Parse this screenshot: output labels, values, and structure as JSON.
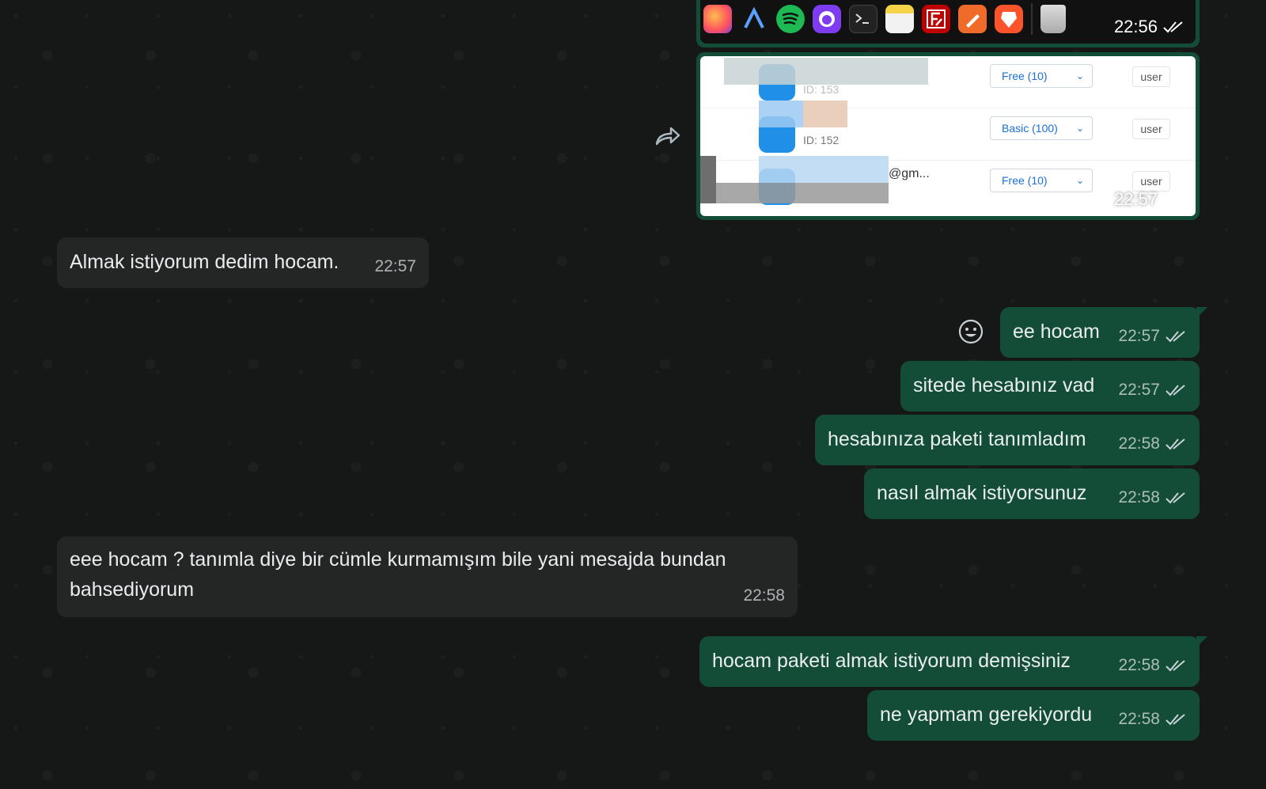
{
  "colors": {
    "background": "#161717",
    "incoming_bubble": "#242626",
    "outgoing_bubble": "#144d37",
    "text": "#e9edef",
    "meta_text": "#a9b0b3"
  },
  "dock": {
    "apps": [
      "firefox-icon",
      "arc-icon",
      "spotify-icon",
      "github-icon",
      "terminal-icon",
      "notes-icon",
      "filezilla-icon",
      "pencil-icon",
      "brave-icon",
      "trash-icon"
    ],
    "time": "22:56"
  },
  "screenshot": {
    "rows": [
      {
        "id": "ID: 153",
        "plan": "Free (10)",
        "role": "user"
      },
      {
        "id": "ID: 152",
        "plan": "Basic (100)",
        "role": "user"
      },
      {
        "email": "@gm...",
        "plan": "Free (10)",
        "role": "user"
      }
    ],
    "time": "22:57"
  },
  "messages": [
    {
      "text": "Almak istiyorum dedim hocam.",
      "time": "22:57"
    },
    {
      "text": "ee hocam",
      "time": "22:57"
    },
    {
      "text": "sitede hesabınız vad",
      "time": "22:57"
    },
    {
      "text": "hesabınıza paketi tanımladım",
      "time": "22:58"
    },
    {
      "text": "nasıl almak istiyorsunuz",
      "time": "22:58"
    },
    {
      "text": "eee hocam ? tanımla diye bir cümle kurmamışım bile yani mesajda bundan bahsediyorum",
      "time": "22:58"
    },
    {
      "text": "hocam paketi almak istiyorum demişsiniz",
      "time": "22:58"
    },
    {
      "text": "ne yapmam gerekiyordu",
      "time": "22:58"
    }
  ]
}
